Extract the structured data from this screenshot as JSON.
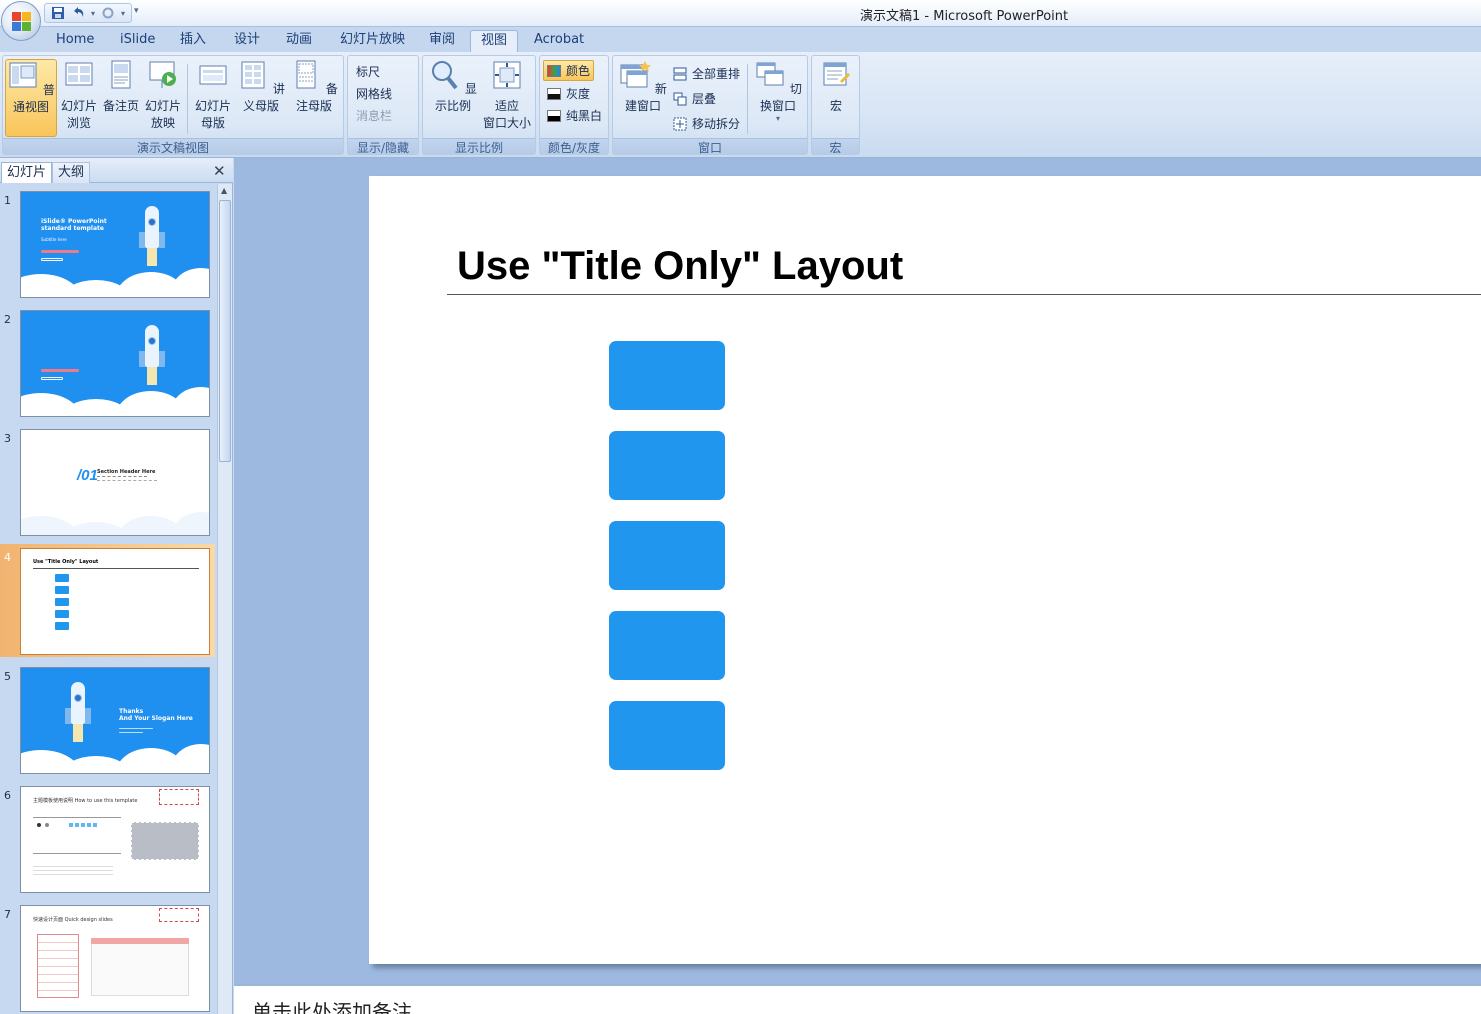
{
  "window": {
    "title": "演示文稿1 - Microsoft PowerPoint"
  },
  "quick_access": [
    "save-icon",
    "undo-icon",
    "redo-icon"
  ],
  "tabs": [
    "Home",
    "iSlide",
    "插入",
    "设计",
    "动画",
    "幻灯片放映",
    "审阅",
    "视图",
    "Acrobat"
  ],
  "active_tab": "视图",
  "ribbon": {
    "presentation_views": {
      "label": "演示文稿视图",
      "normal": "普通视图",
      "sorter": "幻灯片\n浏览",
      "notes_page": "备注页",
      "slideshow": "幻灯片\n放映",
      "slide_master": "幻灯片\n母版",
      "handout_master": "讲义母版",
      "notes_master": "备注母版"
    },
    "show_hide": {
      "label": "显示/隐藏",
      "ruler": "标尺",
      "gridlines": "网格线",
      "message_bar": "消息栏"
    },
    "zoom": {
      "label": "显示比例",
      "zoom": "显示比例",
      "fit": "适应\n窗口大小"
    },
    "color": {
      "label": "颜色/灰度",
      "color": "颜色",
      "grayscale": "灰度",
      "bw": "纯黑白"
    },
    "window": {
      "label": "窗口",
      "new_window": "新建窗口",
      "arrange_all": "全部重排",
      "cascade": "层叠",
      "move_split": "移动拆分",
      "switch": "切换窗口"
    },
    "macro": {
      "label": "宏",
      "macros": "宏"
    }
  },
  "panel": {
    "tab_slides": "幻灯片",
    "tab_outline": "大纲",
    "selected": 4,
    "thumbs": [
      {
        "num": "1",
        "title": "iSlide® PowerPoint\nstandard template",
        "subtitle": "Subtitle here"
      },
      {
        "num": "2"
      },
      {
        "num": "3",
        "section": "/01",
        "section_title": "Section Header Here"
      },
      {
        "num": "4",
        "title": "Use \"Title Only\" Layout"
      },
      {
        "num": "5",
        "title": "Thanks\nAnd Your Slogan Here"
      },
      {
        "num": "6",
        "title": "主题模板使用说明  How to use this template"
      },
      {
        "num": "7",
        "title": "快速设计页面  Quick design slides"
      }
    ]
  },
  "slide": {
    "title": "Use \"Title Only\" Layout",
    "accent": "#2196EE"
  },
  "notes": {
    "placeholder": "单击此处添加备注"
  }
}
